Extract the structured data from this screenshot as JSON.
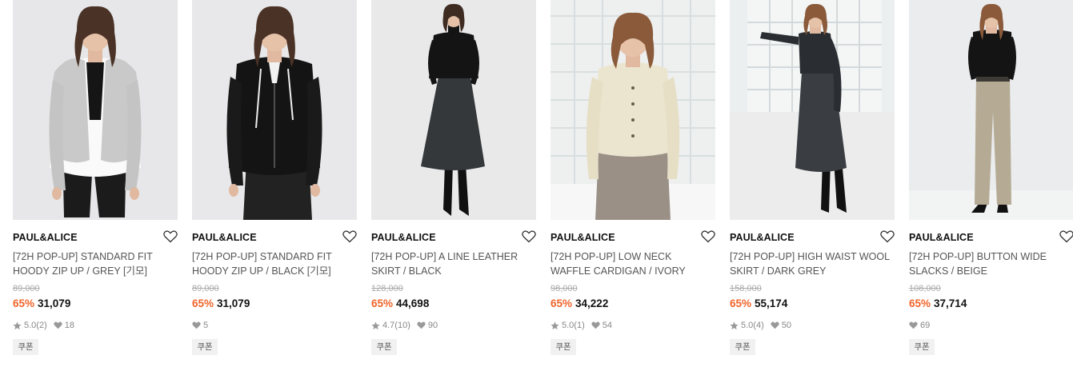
{
  "products": [
    {
      "brand": "PAUL&ALICE",
      "name": "[72H POP-UP] STANDARD FIT HOODY ZIP UP / GREY [기모]",
      "original_price": "89,000",
      "discount": "65%",
      "price": "31,079",
      "rating": "5.0",
      "reviews": "(2)",
      "likes": "18",
      "coupon": "쿠폰"
    },
    {
      "brand": "PAUL&ALICE",
      "name": "[72H POP-UP] STANDARD FIT HOODY ZIP UP / BLACK [기모]",
      "original_price": "89,000",
      "discount": "65%",
      "price": "31,079",
      "rating": "",
      "reviews": "",
      "likes": "5",
      "coupon": "쿠폰"
    },
    {
      "brand": "PAUL&ALICE",
      "name": "[72H POP-UP] A LINE LEATHER SKIRT / BLACK",
      "original_price": "128,000",
      "discount": "65%",
      "price": "44,698",
      "rating": "4.7",
      "reviews": "(10)",
      "likes": "90",
      "coupon": "쿠폰"
    },
    {
      "brand": "PAUL&ALICE",
      "name": "[72H POP-UP] LOW NECK WAFFLE CARDIGAN / IVORY",
      "original_price": "98,000",
      "discount": "65%",
      "price": "34,222",
      "rating": "5.0",
      "reviews": "(1)",
      "likes": "54",
      "coupon": "쿠폰"
    },
    {
      "brand": "PAUL&ALICE",
      "name": "[72H POP-UP] HIGH WAIST WOOL SKIRT / DARK GREY",
      "original_price": "158,000",
      "discount": "65%",
      "price": "55,174",
      "rating": "5.0",
      "reviews": "(4)",
      "likes": "50",
      "coupon": "쿠폰"
    },
    {
      "brand": "PAUL&ALICE",
      "name": "[72H POP-UP] BUTTON WIDE SLACKS / BEIGE",
      "original_price": "108,000",
      "discount": "65%",
      "price": "37,714",
      "rating": "",
      "reviews": "",
      "likes": "69",
      "coupon": "쿠폰"
    }
  ],
  "colors": {
    "discount": "#f0642a",
    "coupon_bg": "#f1f1f1"
  },
  "icons": {
    "wishlist": "heart-outline-icon",
    "rating": "star-icon",
    "likes": "heart-filled-icon"
  }
}
